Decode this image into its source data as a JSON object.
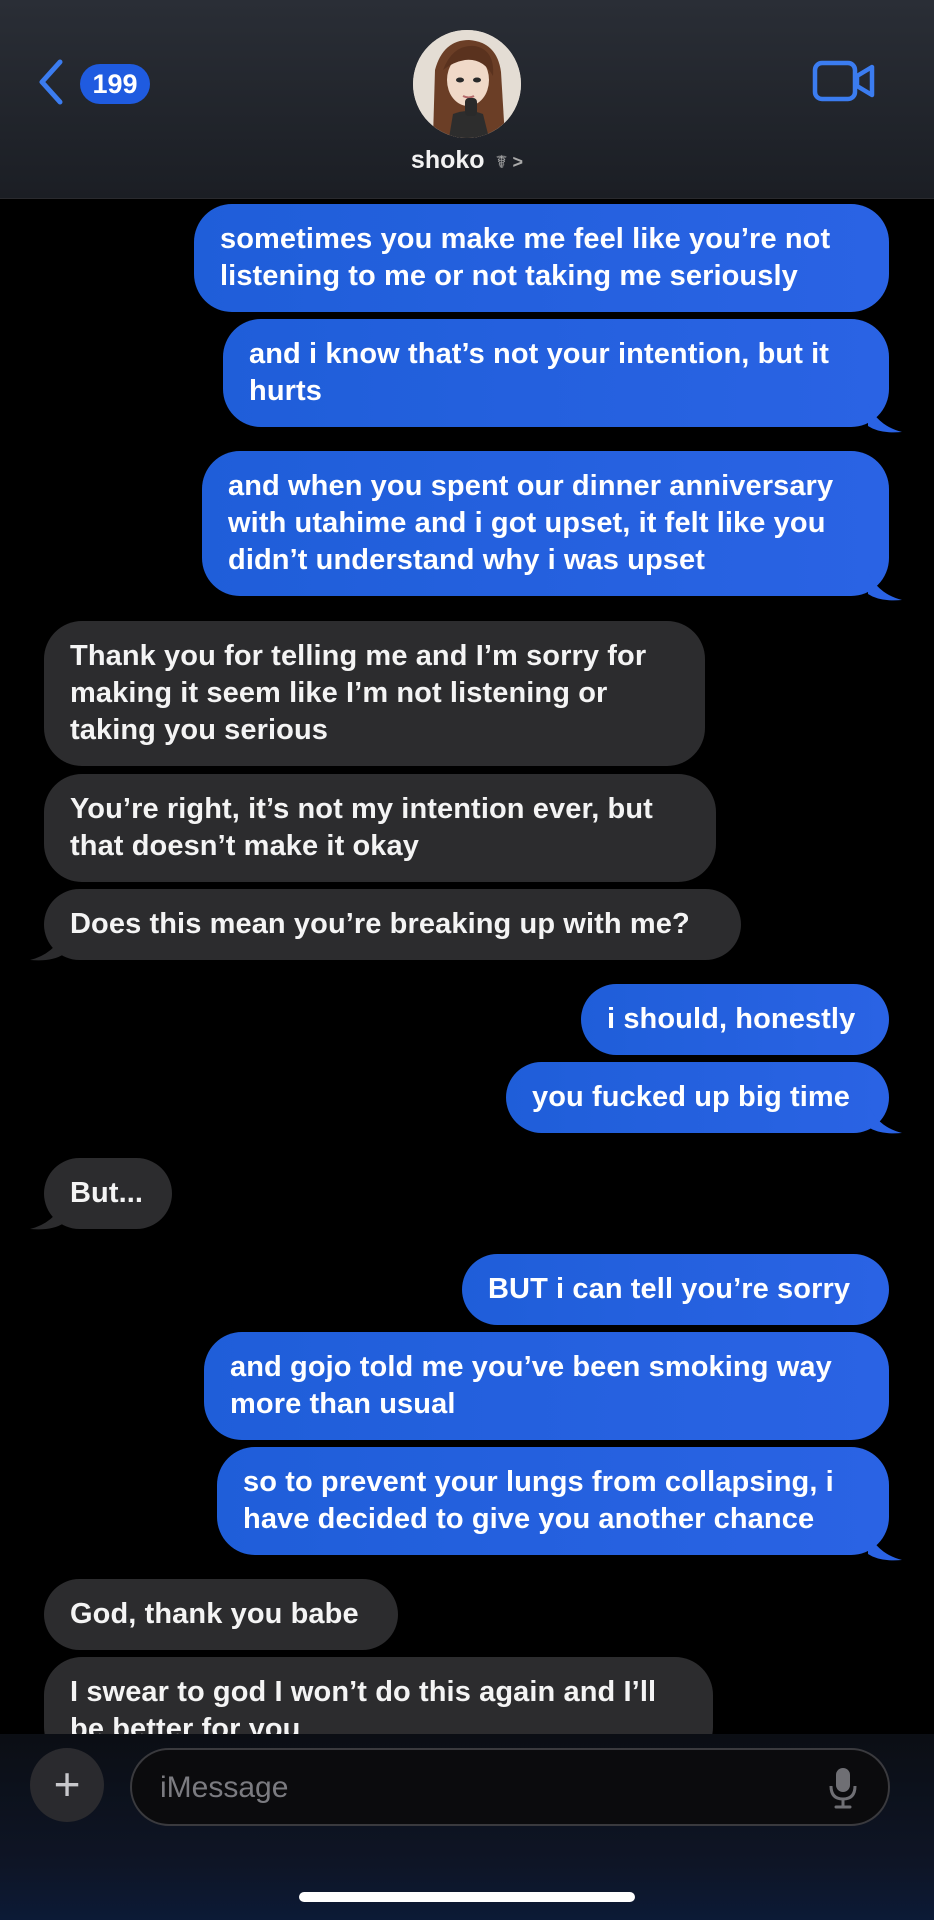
{
  "header": {
    "back_badge": "199",
    "contact_name": "shoko",
    "contact_suffix": "☤ >"
  },
  "messages": [
    {
      "side": "out",
      "text": "sometimes you make me feel like you’re not listening to me or not taking me seriously"
    },
    {
      "side": "out",
      "text": "and i know that’s not your intention, but it hurts"
    },
    {
      "side": "out",
      "text": "and when you spent our dinner anniversary with utahime and i got upset, it felt like you didn’t understand why i was upset"
    },
    {
      "side": "in",
      "text": "Thank you for telling me and I’m sorry for making it seem like I’m not listening or taking you serious"
    },
    {
      "side": "in",
      "text": "You’re right, it’s not my intention ever, but that doesn’t make it okay"
    },
    {
      "side": "in",
      "text": "Does this mean you’re breaking up with me?"
    },
    {
      "side": "out",
      "text": "i should, honestly"
    },
    {
      "side": "out",
      "text": "you fucked up big time"
    },
    {
      "side": "in",
      "text": "But..."
    },
    {
      "side": "out",
      "text": "BUT i can tell you’re sorry"
    },
    {
      "side": "out",
      "text": "and gojo told me you’ve been smoking way more than usual"
    },
    {
      "side": "out",
      "text": "so to prevent your lungs from collapsing, i have decided to give you another chance"
    },
    {
      "side": "in",
      "text": "God, thank you babe"
    },
    {
      "side": "in",
      "text": "I swear to god I won’t do this again and I’ll be better for you"
    }
  ],
  "composer": {
    "placeholder": "iMessage"
  },
  "colors": {
    "outgoing": "#2a63e4",
    "incoming": "#2c2c2e",
    "accent": "#1f5be0"
  },
  "icons": [
    "chevron-left-icon",
    "video-camera-icon",
    "plus-icon",
    "microphone-icon"
  ]
}
